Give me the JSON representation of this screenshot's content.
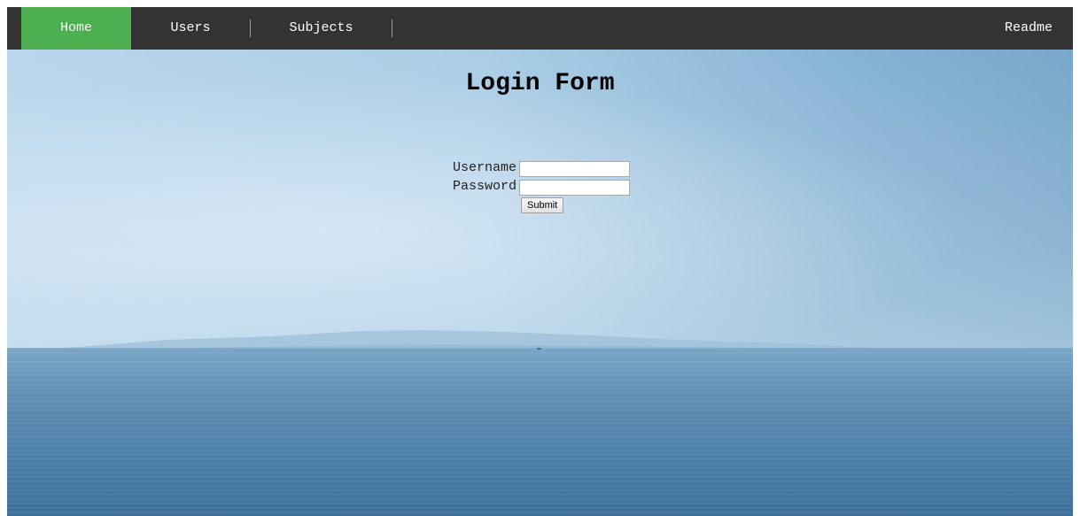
{
  "navbar": {
    "items": [
      {
        "label": "Home",
        "active": true
      },
      {
        "label": "Users",
        "active": false
      },
      {
        "label": "Subjects",
        "active": false
      }
    ],
    "right_item": {
      "label": "Readme"
    },
    "background": "#333333",
    "active_color": "#4caf50"
  },
  "login": {
    "title": "Login Form",
    "username_label": "Username",
    "username_value": "",
    "password_label": "Password",
    "password_value": "",
    "submit_label": "Submit"
  }
}
